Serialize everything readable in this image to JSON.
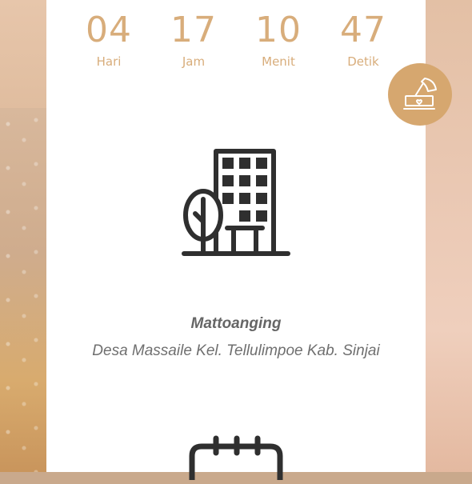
{
  "countdown": {
    "days": {
      "value": "04",
      "label": "Hari"
    },
    "hours": {
      "value": "17",
      "label": "Jam"
    },
    "minutes": {
      "value": "10",
      "label": "Menit"
    },
    "seconds": {
      "value": "47",
      "label": "Detik"
    }
  },
  "music_button": {
    "icon": "gramophone-icon"
  },
  "venue": {
    "icon": "building-icon",
    "name": "Mattoanging",
    "address": "Desa Massaile Kel. Tellulimpoe Kab. Sinjai"
  },
  "next_section": {
    "icon": "calendar-icon"
  },
  "colors": {
    "accent": "#d8ad7b",
    "button": "#d6a76f",
    "icon": "#2f2f2f",
    "text": "#666666"
  }
}
